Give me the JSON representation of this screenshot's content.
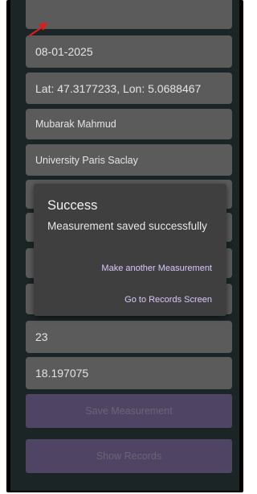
{
  "form": {
    "date": "08-01-2025",
    "location": "Lat: 47.3177233, Lon: 5.0688467",
    "name": "Mubarak Mahmud",
    "institution": "University Paris Saclay",
    "value_1": "23",
    "value_2": "18.197075"
  },
  "buttons": {
    "save": "Save Measurement",
    "show": "Show Records"
  },
  "dialog": {
    "title": "Success",
    "message": "Measurement saved successfully",
    "action_another": "Make another Measurement",
    "action_records": "Go to Records Screen"
  },
  "colors": {
    "screen_bg": "#1b2526",
    "field_bg": "#5b5b5b",
    "dialog_bg": "#3f3f3f",
    "accent_text": "#d9c8ff",
    "button_bg": "#4f4463",
    "pointer_arrow": "#e01b1b"
  },
  "icons": {
    "pointer": "red-arrow-icon"
  }
}
